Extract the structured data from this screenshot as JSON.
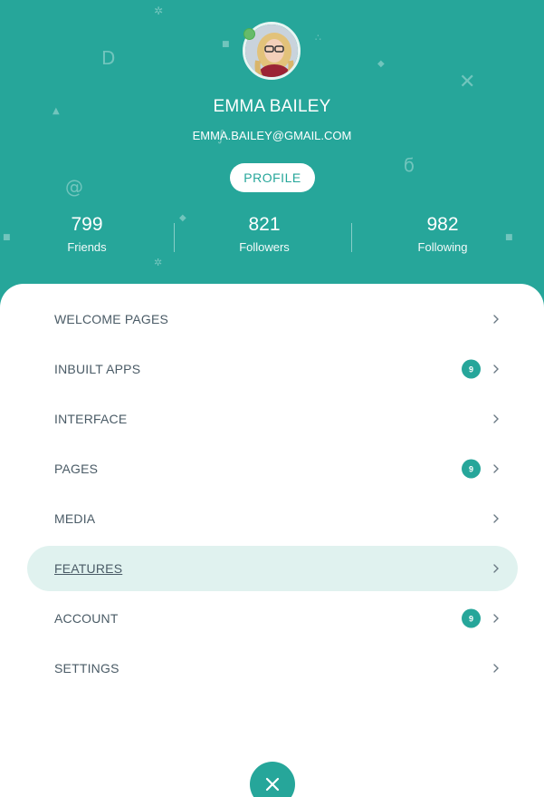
{
  "theme": {
    "accent": "#26a69a",
    "active_row": "#e0f2ef",
    "text": "#4a5b66",
    "online": "#66bb6a"
  },
  "user": {
    "name": "EMMA BAILEY",
    "email": "EMMA.BAILEY@GMAIL.COM",
    "profile_label": "PROFILE",
    "online": true
  },
  "stats": [
    {
      "value": "799",
      "label": "Friends"
    },
    {
      "value": "821",
      "label": "Followers"
    },
    {
      "value": "982",
      "label": "Following"
    }
  ],
  "menu": [
    {
      "label": "WELCOME PAGES",
      "badge": null,
      "active": false
    },
    {
      "label": "INBUILT APPS",
      "badge": "9",
      "active": false
    },
    {
      "label": "INTERFACE",
      "badge": null,
      "active": false
    },
    {
      "label": "PAGES",
      "badge": "9",
      "active": false
    },
    {
      "label": "MEDIA",
      "badge": null,
      "active": false
    },
    {
      "label": "FEATURES",
      "badge": null,
      "active": true
    },
    {
      "label": "ACCOUNT",
      "badge": "9",
      "active": false
    },
    {
      "label": "SETTINGS",
      "badge": null,
      "active": false
    }
  ],
  "icons": {
    "chevron": "chevron-right-icon",
    "close": "close-icon"
  }
}
